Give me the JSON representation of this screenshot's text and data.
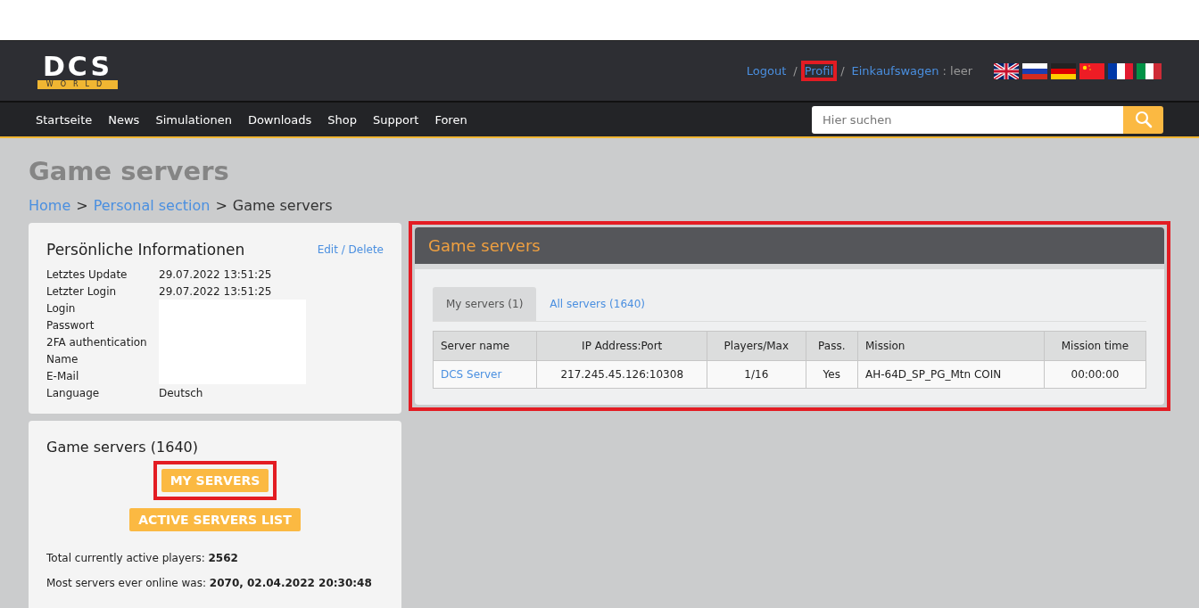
{
  "logo": {
    "mark": "DCS",
    "sub": "WORLD"
  },
  "user_links": [
    {
      "label": "Logout",
      "highlighted": false
    },
    {
      "label": "Profil",
      "highlighted": true
    },
    {
      "label": "Einkaufswagen",
      "highlighted": false
    }
  ],
  "link_separator": "/",
  "cart_status": ": leer",
  "nav": [
    "Startseite",
    "News",
    "Simulationen",
    "Downloads",
    "Shop",
    "Support",
    "Foren"
  ],
  "search": {
    "placeholder": "Hier suchen"
  },
  "page_title": "Game servers",
  "breadcrumb_separator": ">",
  "breadcrumb": [
    {
      "label": "Home",
      "link": true
    },
    {
      "label": "Personal section",
      "link": true
    },
    {
      "label": "Game servers",
      "link": false
    }
  ],
  "personal_info": {
    "title": "Persönliche Informationen",
    "edit_link": "Edit / Delete",
    "rows": [
      {
        "label": "Letztes Update",
        "value": "29.07.2022 13:51:25",
        "redacted": false
      },
      {
        "label": "Letzter Login",
        "value": "29.07.2022 13:51:25",
        "redacted": false
      },
      {
        "label": "Login",
        "redacted": true
      },
      {
        "label": "Passwort",
        "redacted": true
      },
      {
        "label": "2FA authentication",
        "redacted": true
      },
      {
        "label": "Name",
        "redacted": true
      },
      {
        "label": "E-Mail",
        "redacted": true
      },
      {
        "label": "Language",
        "value": "Deutsch",
        "redacted": false
      }
    ]
  },
  "servers_box": {
    "title": "Game servers (1640)",
    "buttons": [
      {
        "label": "MY SERVERS",
        "highlighted": true
      },
      {
        "label": "ACTIVE SERVERS LIST",
        "highlighted": false
      }
    ],
    "stats": [
      "Total currently active players: **2562**",
      "Most servers ever online was: **2070, 02.04.2022 20:30:48**"
    ]
  },
  "servers_panel": {
    "title": "Game servers",
    "highlighted": true,
    "tabs": [
      {
        "label": "My servers (1)",
        "selected": true
      },
      {
        "label": "All servers (1640)",
        "selected": false
      }
    ],
    "columns": [
      "Server name",
      "IP Address:Port",
      "Players/Max",
      "Pass.",
      "Mission",
      "Mission time"
    ],
    "rows": [
      [
        "DCS Server",
        "217.245.45.126:10308",
        "1/16",
        "Yes",
        "AH-64D_SP_PG_Mtn COIN",
        "00:00:00"
      ]
    ]
  }
}
